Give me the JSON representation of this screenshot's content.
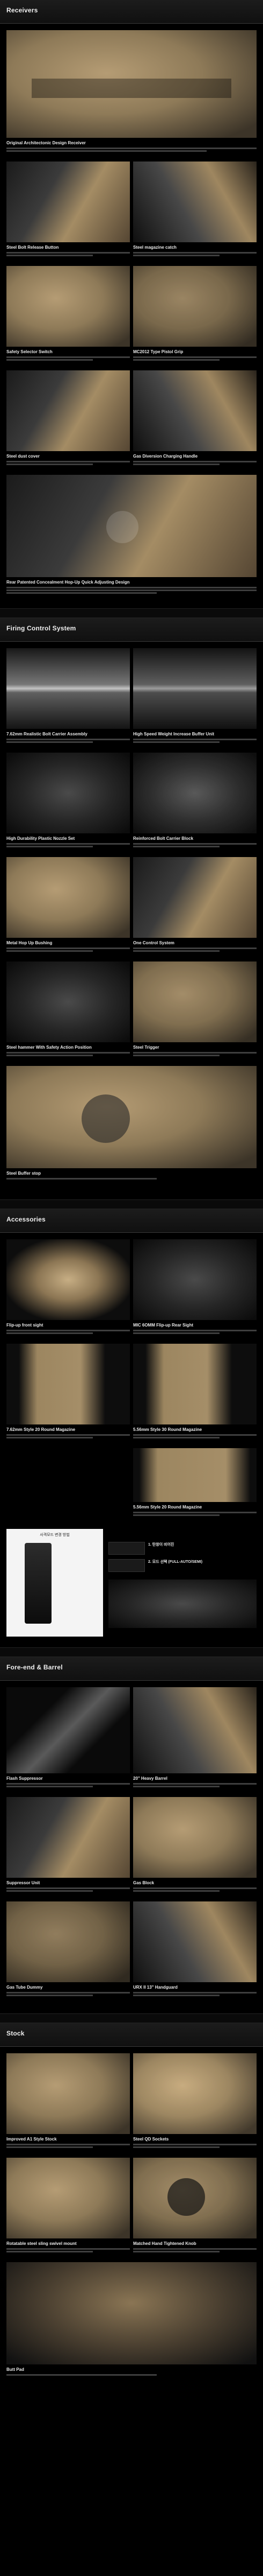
{
  "sections": {
    "receivers": {
      "title": "Receivers"
    },
    "firing": {
      "title": "Firing Control System"
    },
    "accessories": {
      "title": "Accessories"
    },
    "foreend": {
      "title": "Fore-end & Barrel"
    },
    "stock": {
      "title": "Stock"
    }
  },
  "receivers": [
    {
      "caption": "Original Architectonic Design Receiver"
    },
    {
      "caption": "Steel Bolt Release Button"
    },
    {
      "caption": "Steel magazine catch"
    },
    {
      "caption": "Safety Selector Switch"
    },
    {
      "caption": "MC2012 Type Pistol Grip"
    },
    {
      "caption": "Steel dust cover"
    },
    {
      "caption": "Gas Diversion Charging Handle"
    },
    {
      "caption": "Rear Patented Concealment Hop-Up Quick Adjusting Design"
    }
  ],
  "firing": [
    {
      "caption": "7.62mm Realistic Bolt Carrier Assembly"
    },
    {
      "caption": "High Speed Weight Increase Buffer Unit"
    },
    {
      "caption": "High Durability Plastic Nozzle Set"
    },
    {
      "caption": "Reinforced Bolt Carrier Block"
    },
    {
      "caption": "Metal Hop Up Bushing"
    },
    {
      "caption": "One Control System"
    },
    {
      "caption": "Steel hammer With Safety Action Position"
    },
    {
      "caption": "Steel Trigger"
    },
    {
      "caption": "Steel Buffer stop"
    }
  ],
  "accessories": [
    {
      "caption": "Flip-up front sight"
    },
    {
      "caption": "MIC 6OMM Flip-up Rear Sight"
    },
    {
      "caption": "7.62mm Style 20 Round Magazine"
    },
    {
      "caption": "5.56mm Style 30 Round Magazine"
    },
    {
      "caption": "5.56mm Style 20 Round Magazine"
    }
  ],
  "diagram": {
    "title": "사격모드 변경 방법",
    "note1": "1. 탄창이 비어진",
    "note2": "2. 모드 선택 (FULL-AUTO/SEMI)"
  },
  "foreend": [
    {
      "caption": "Flash Suppressor"
    },
    {
      "caption": "20\" Heavy Barrel"
    },
    {
      "caption": "Suppressor Unit"
    },
    {
      "caption": "Gas Block"
    },
    {
      "caption": "Gas Tube Dummy"
    },
    {
      "caption": "URX II 13\" Handguard"
    }
  ],
  "stock": [
    {
      "caption": "Improved A1 Style Stock"
    },
    {
      "caption": "Steel QD Sockets"
    },
    {
      "caption": "Rotatable steel sling swivel mount"
    },
    {
      "caption": "Matched Hand Tightened Knob"
    },
    {
      "caption": "Butt Pad"
    }
  ]
}
